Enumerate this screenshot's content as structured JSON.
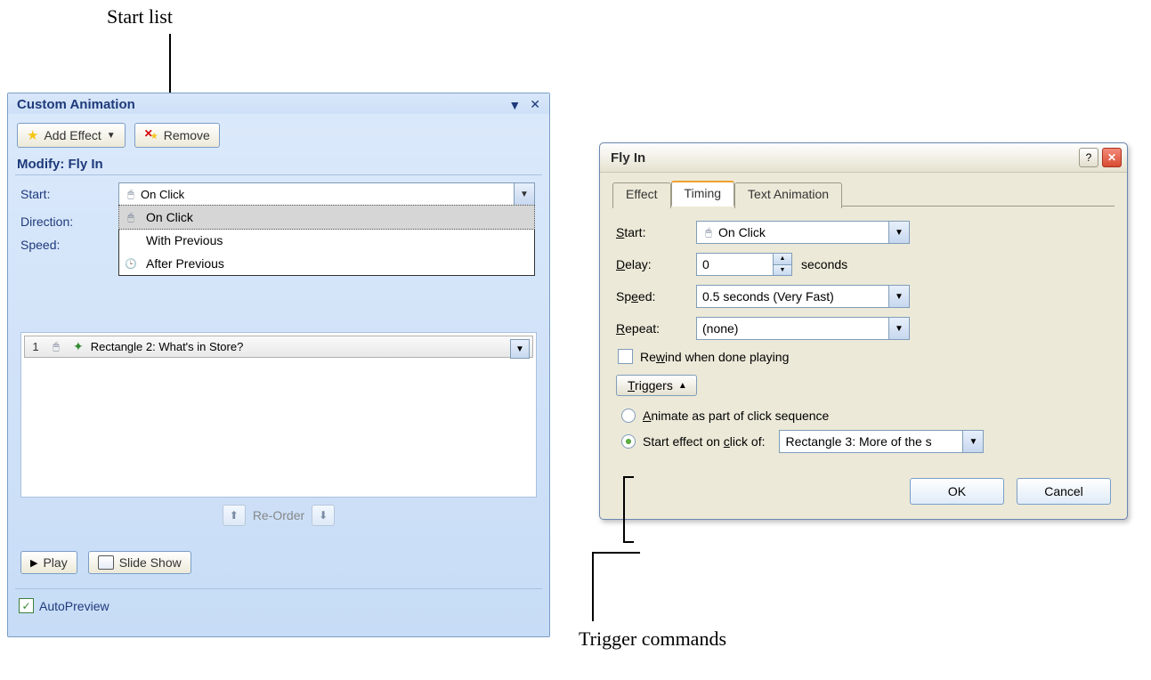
{
  "callouts": {
    "start_list": "Start list",
    "trigger_commands": "Trigger commands"
  },
  "taskpane": {
    "title": "Custom Animation",
    "add_effect": "Add Effect",
    "remove": "Remove",
    "modify_label": "Modify: Fly In",
    "start_label": "Start:",
    "direction_label": "Direction:",
    "speed_label": "Speed:",
    "start_value": "On Click",
    "start_options": {
      "on_click": "On Click",
      "with_previous": "With Previous",
      "after_previous": "After Previous"
    },
    "anim_items": [
      {
        "seq": "1",
        "label": "Rectangle 2: What's in Store?"
      }
    ],
    "reorder": "Re-Order",
    "play": "Play",
    "slideshow": "Slide Show",
    "autopreview": "AutoPreview"
  },
  "dialog": {
    "title": "Fly In",
    "tabs": {
      "effect": "Effect",
      "timing": "Timing",
      "text_anim": "Text Animation"
    },
    "start_label": "Start:",
    "start_value": "On Click",
    "delay_label": "Delay:",
    "delay_value": "0",
    "delay_unit": "seconds",
    "speed_label": "Speed:",
    "speed_value": "0.5 seconds (Very Fast)",
    "repeat_label": "Repeat:",
    "repeat_value": "(none)",
    "rewind": "Rewind when done playing",
    "triggers": "Triggers",
    "radio_seq": "Animate as part of click sequence",
    "radio_click_of": "Start effect on click of:",
    "click_of_value": "Rectangle 3: More of the s",
    "ok": "OK",
    "cancel": "Cancel"
  }
}
